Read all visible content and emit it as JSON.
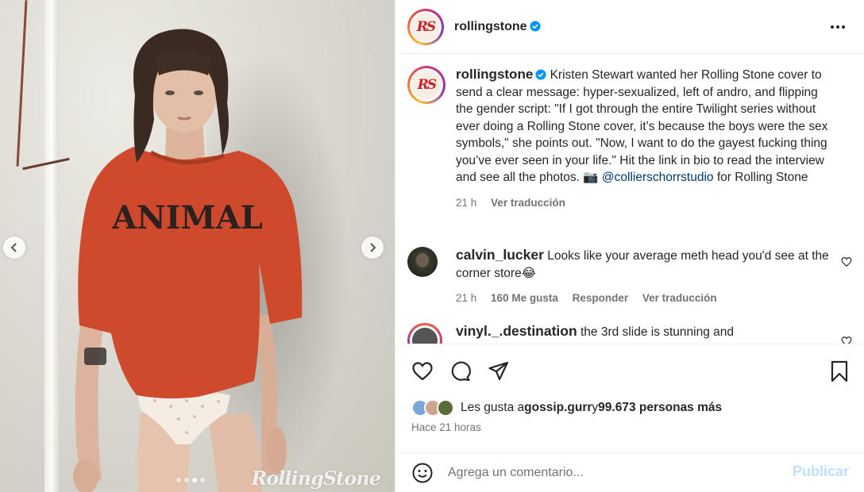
{
  "media": {
    "watermark": "RollingStone",
    "shirt_text": "ANIMAL",
    "slides_total": 4,
    "slide_active": 3
  },
  "account": {
    "username": "rollingstone",
    "avatar_logo": "RS",
    "verified": true
  },
  "caption": {
    "username": "rollingstone",
    "text_before_mention": "Kristen Stewart wanted her Rolling Stone cover to send a clear message: hyper-sexualized, left of andro, and flipping the gender script: \"If I got through the entire Twilight series without ever doing a Rolling Stone cover, it’s because the boys were the sex symbols,\" she points out. \"Now, I want to do the gayest fucking thing you’ve ever seen in your life.\" Hit the link in bio to read the interview and see all the photos. 📷 ",
    "mention": "@collierschorrstudio",
    "text_after_mention": " for Rolling Stone",
    "time": "21 h",
    "translate": "Ver traducción"
  },
  "comments": [
    {
      "username": "calvin_lucker",
      "text": "Looks like your average meth head you'd see at the corner store😂",
      "time": "21 h",
      "likes": "160 Me gusta",
      "reply": "Responder",
      "translate": "Ver traducción"
    },
    {
      "username": "vinyl._.destination",
      "text": "the 3rd slide is stunning and"
    }
  ],
  "likes": {
    "prefix": "Les gusta a ",
    "first_user": "gossip.gurr",
    "connector": " y ",
    "others": "99.673 personas más",
    "liker_colors": [
      "#7aa6d8",
      "#c9a68c",
      "#5c6b3a"
    ]
  },
  "timestamp": "Hace 21 horas",
  "add_comment": {
    "placeholder": "Agrega un comentario...",
    "post_label": "Publicar"
  },
  "colors": {
    "link": "#00376b",
    "muted": "#737373",
    "post_disabled": "#c0dffd",
    "verified": "#0095f6",
    "shirt": "#cf4a2c"
  }
}
